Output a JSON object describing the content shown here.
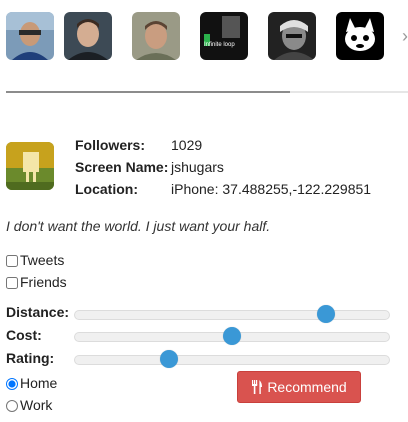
{
  "avatars": [
    {
      "alt": "user-avatar-1"
    },
    {
      "alt": "user-avatar-2"
    },
    {
      "alt": "user-avatar-3"
    },
    {
      "alt": "user-avatar-4",
      "text": "Infinite loop"
    },
    {
      "alt": "user-avatar-5"
    },
    {
      "alt": "user-avatar-6"
    }
  ],
  "more_icon": "chevron-right-icon",
  "profile": {
    "followers_label": "Followers:",
    "followers_value": "1029",
    "screen_name_label": "Screen Name:",
    "screen_name_value": "jshugars",
    "location_label": "Location:",
    "location_value": "iPhone: 37.488255,-122.229851",
    "bio": "I don't want the world. I just want your half."
  },
  "filters": {
    "tweets_label": "Tweets",
    "friends_label": "Friends"
  },
  "sliders": {
    "distance_label": "Distance:",
    "distance_value": 0.8,
    "cost_label": "Cost:",
    "cost_value": 0.5,
    "rating_label": "Rating:",
    "rating_value": 0.3
  },
  "location_mode": {
    "home_label": "Home",
    "work_label": "Work",
    "selected": "Home"
  },
  "actions": {
    "recommend_label": "Recommend",
    "recommend_icon": "fork-knife-icon"
  },
  "colors": {
    "accent": "#3a98d6",
    "button": "#d9534f"
  }
}
